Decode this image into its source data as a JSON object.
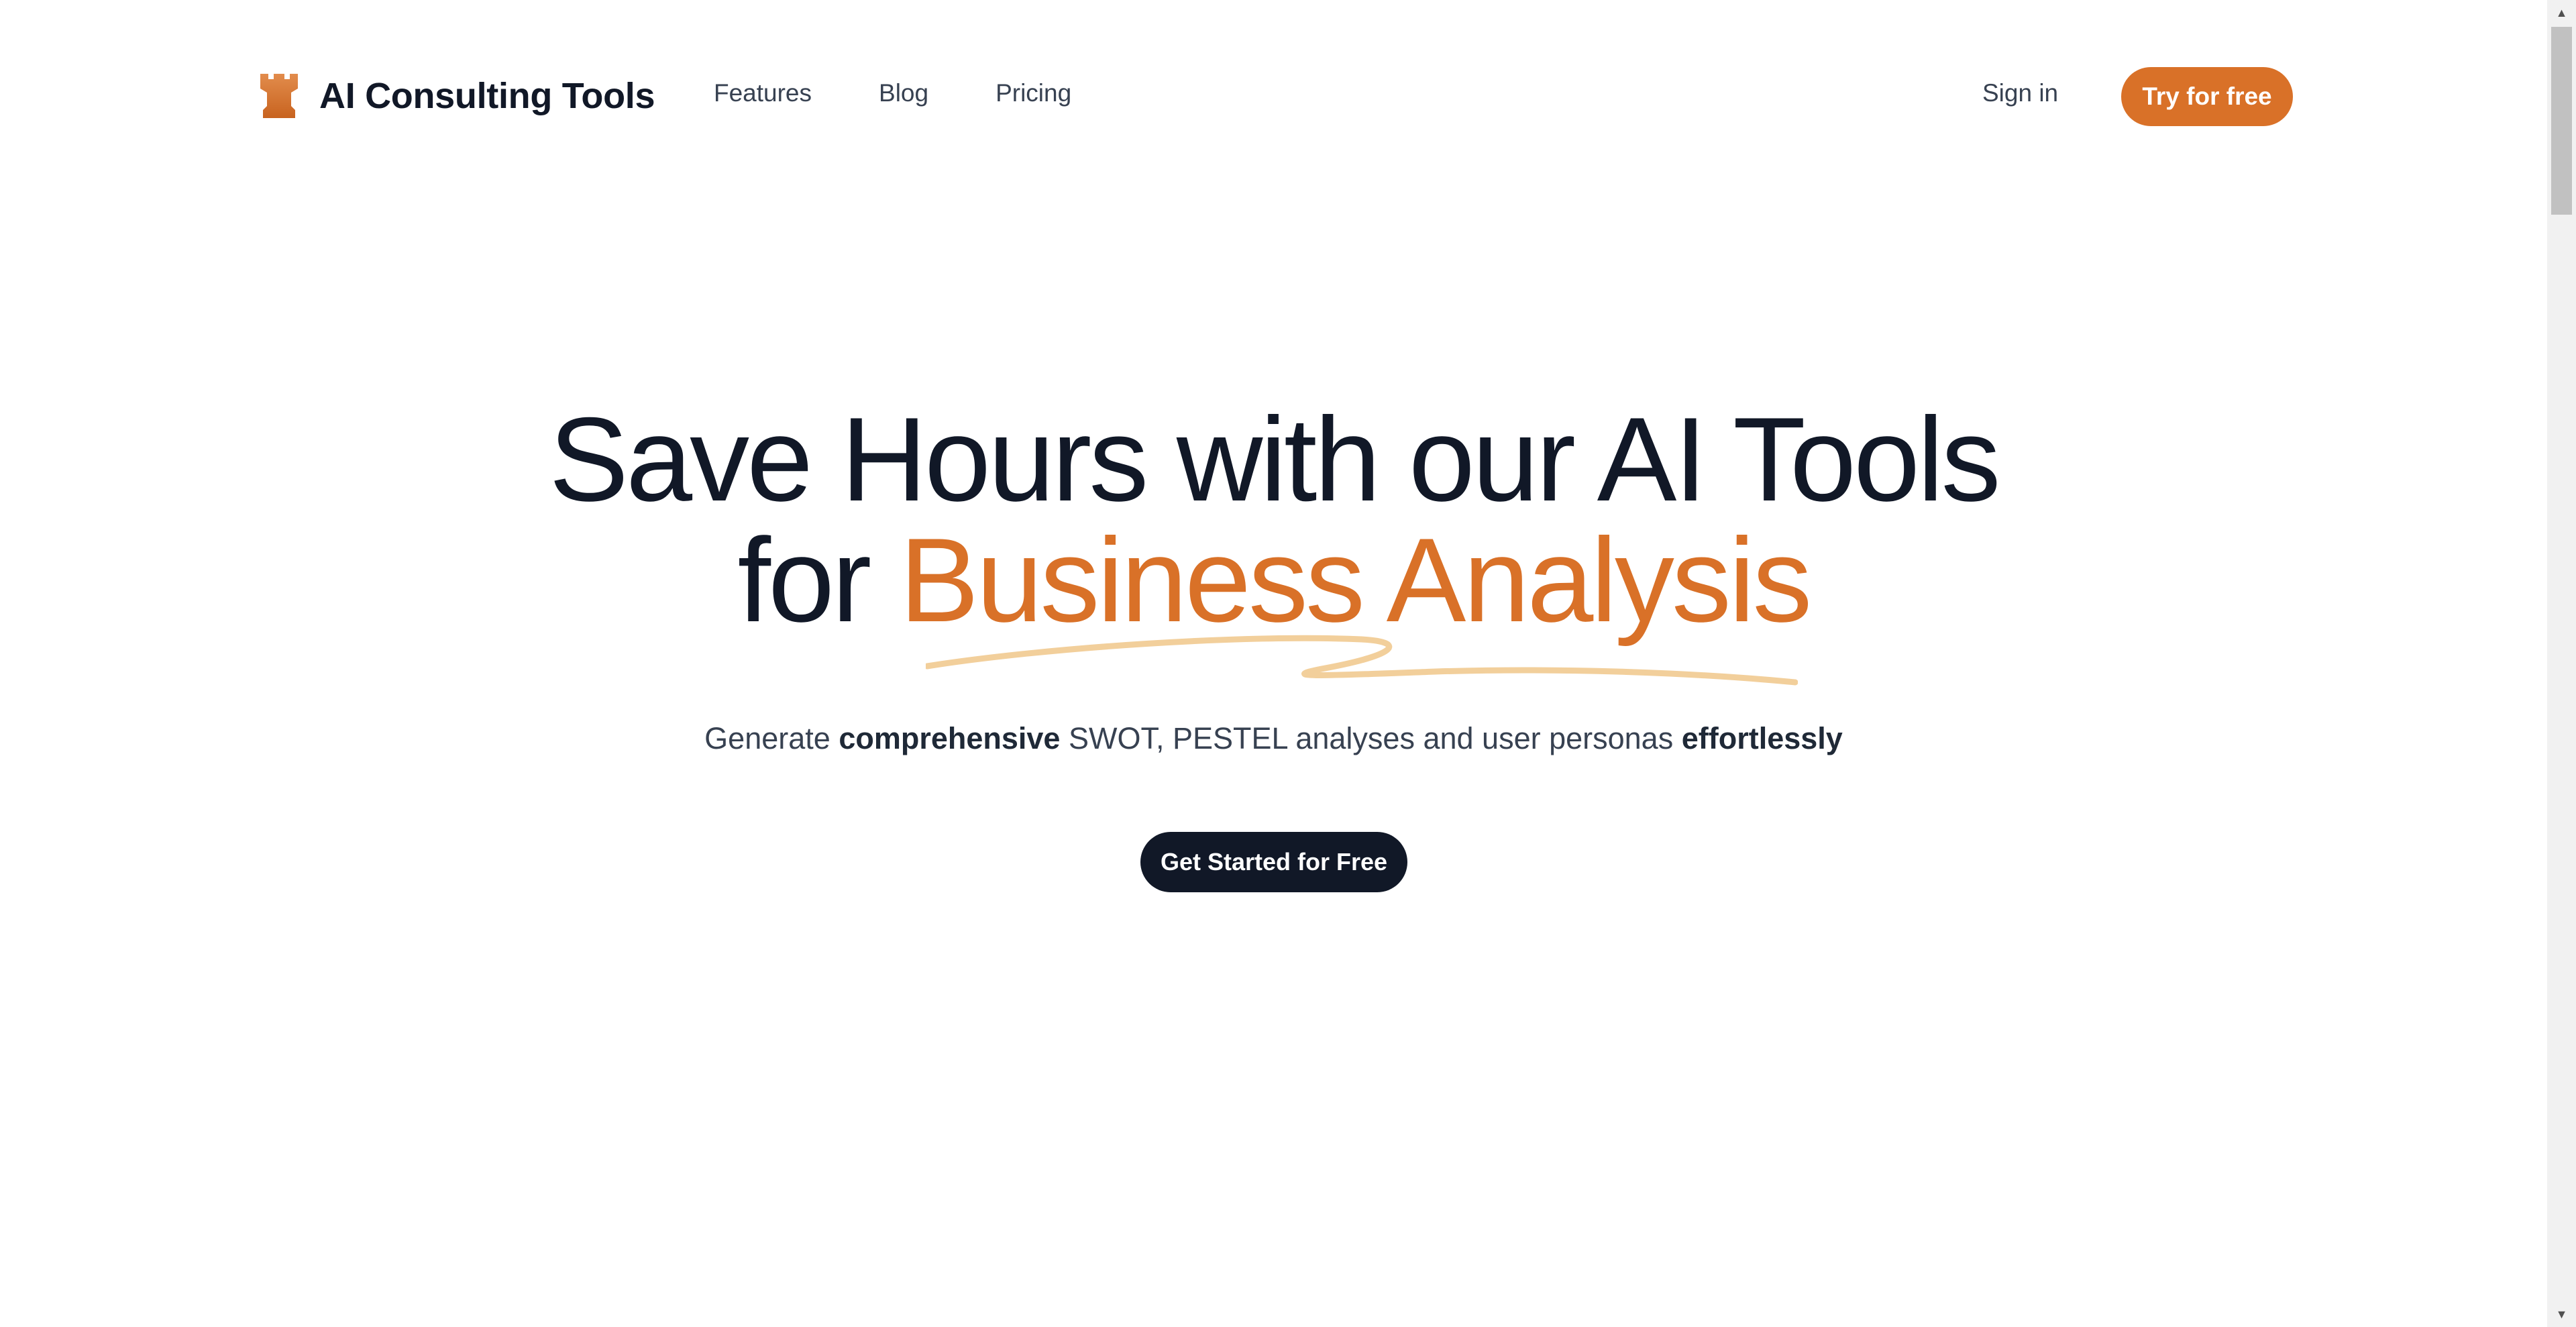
{
  "header": {
    "brand": "AI Consulting Tools",
    "logo_icon": "rook-icon",
    "nav": [
      {
        "label": "Features"
      },
      {
        "label": "Blog"
      },
      {
        "label": "Pricing"
      }
    ],
    "sign_in_label": "Sign in",
    "try_label": "Try for free"
  },
  "hero": {
    "title_line1": "Save Hours with our AI Tools",
    "title_line2_prefix": "for ",
    "title_line2_accent": "Business Analysis",
    "subtitle": {
      "part1": "Generate ",
      "bold1": "comprehensive",
      "part2": " SWOT, PESTEL analyses and user personas ",
      "bold2": "effortlessly"
    },
    "cta_label": "Get Started for Free"
  },
  "colors": {
    "accent": "#d97128",
    "dark": "#111827",
    "squiggle": "#f2cf9b"
  }
}
